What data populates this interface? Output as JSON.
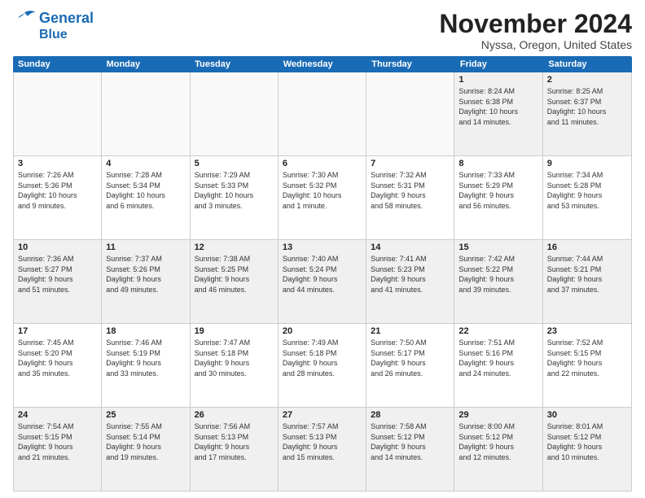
{
  "logo": {
    "line1": "General",
    "line2": "Blue"
  },
  "title": "November 2024",
  "subtitle": "Nyssa, Oregon, United States",
  "days_of_week": [
    "Sunday",
    "Monday",
    "Tuesday",
    "Wednesday",
    "Thursday",
    "Friday",
    "Saturday"
  ],
  "weeks": [
    [
      {
        "day": "",
        "info": "",
        "empty": true
      },
      {
        "day": "",
        "info": "",
        "empty": true
      },
      {
        "day": "",
        "info": "",
        "empty": true
      },
      {
        "day": "",
        "info": "",
        "empty": true
      },
      {
        "day": "",
        "info": "",
        "empty": true
      },
      {
        "day": "1",
        "info": "Sunrise: 8:24 AM\nSunset: 6:38 PM\nDaylight: 10 hours\nand 14 minutes."
      },
      {
        "day": "2",
        "info": "Sunrise: 8:25 AM\nSunset: 6:37 PM\nDaylight: 10 hours\nand 11 minutes."
      }
    ],
    [
      {
        "day": "3",
        "info": "Sunrise: 7:26 AM\nSunset: 5:36 PM\nDaylight: 10 hours\nand 9 minutes."
      },
      {
        "day": "4",
        "info": "Sunrise: 7:28 AM\nSunset: 5:34 PM\nDaylight: 10 hours\nand 6 minutes."
      },
      {
        "day": "5",
        "info": "Sunrise: 7:29 AM\nSunset: 5:33 PM\nDaylight: 10 hours\nand 3 minutes."
      },
      {
        "day": "6",
        "info": "Sunrise: 7:30 AM\nSunset: 5:32 PM\nDaylight: 10 hours\nand 1 minute."
      },
      {
        "day": "7",
        "info": "Sunrise: 7:32 AM\nSunset: 5:31 PM\nDaylight: 9 hours\nand 58 minutes."
      },
      {
        "day": "8",
        "info": "Sunrise: 7:33 AM\nSunset: 5:29 PM\nDaylight: 9 hours\nand 56 minutes."
      },
      {
        "day": "9",
        "info": "Sunrise: 7:34 AM\nSunset: 5:28 PM\nDaylight: 9 hours\nand 53 minutes."
      }
    ],
    [
      {
        "day": "10",
        "info": "Sunrise: 7:36 AM\nSunset: 5:27 PM\nDaylight: 9 hours\nand 51 minutes."
      },
      {
        "day": "11",
        "info": "Sunrise: 7:37 AM\nSunset: 5:26 PM\nDaylight: 9 hours\nand 49 minutes."
      },
      {
        "day": "12",
        "info": "Sunrise: 7:38 AM\nSunset: 5:25 PM\nDaylight: 9 hours\nand 46 minutes."
      },
      {
        "day": "13",
        "info": "Sunrise: 7:40 AM\nSunset: 5:24 PM\nDaylight: 9 hours\nand 44 minutes."
      },
      {
        "day": "14",
        "info": "Sunrise: 7:41 AM\nSunset: 5:23 PM\nDaylight: 9 hours\nand 41 minutes."
      },
      {
        "day": "15",
        "info": "Sunrise: 7:42 AM\nSunset: 5:22 PM\nDaylight: 9 hours\nand 39 minutes."
      },
      {
        "day": "16",
        "info": "Sunrise: 7:44 AM\nSunset: 5:21 PM\nDaylight: 9 hours\nand 37 minutes."
      }
    ],
    [
      {
        "day": "17",
        "info": "Sunrise: 7:45 AM\nSunset: 5:20 PM\nDaylight: 9 hours\nand 35 minutes."
      },
      {
        "day": "18",
        "info": "Sunrise: 7:46 AM\nSunset: 5:19 PM\nDaylight: 9 hours\nand 33 minutes."
      },
      {
        "day": "19",
        "info": "Sunrise: 7:47 AM\nSunset: 5:18 PM\nDaylight: 9 hours\nand 30 minutes."
      },
      {
        "day": "20",
        "info": "Sunrise: 7:49 AM\nSunset: 5:18 PM\nDaylight: 9 hours\nand 28 minutes."
      },
      {
        "day": "21",
        "info": "Sunrise: 7:50 AM\nSunset: 5:17 PM\nDaylight: 9 hours\nand 26 minutes."
      },
      {
        "day": "22",
        "info": "Sunrise: 7:51 AM\nSunset: 5:16 PM\nDaylight: 9 hours\nand 24 minutes."
      },
      {
        "day": "23",
        "info": "Sunrise: 7:52 AM\nSunset: 5:15 PM\nDaylight: 9 hours\nand 22 minutes."
      }
    ],
    [
      {
        "day": "24",
        "info": "Sunrise: 7:54 AM\nSunset: 5:15 PM\nDaylight: 9 hours\nand 21 minutes."
      },
      {
        "day": "25",
        "info": "Sunrise: 7:55 AM\nSunset: 5:14 PM\nDaylight: 9 hours\nand 19 minutes."
      },
      {
        "day": "26",
        "info": "Sunrise: 7:56 AM\nSunset: 5:13 PM\nDaylight: 9 hours\nand 17 minutes."
      },
      {
        "day": "27",
        "info": "Sunrise: 7:57 AM\nSunset: 5:13 PM\nDaylight: 9 hours\nand 15 minutes."
      },
      {
        "day": "28",
        "info": "Sunrise: 7:58 AM\nSunset: 5:12 PM\nDaylight: 9 hours\nand 14 minutes."
      },
      {
        "day": "29",
        "info": "Sunrise: 8:00 AM\nSunset: 5:12 PM\nDaylight: 9 hours\nand 12 minutes."
      },
      {
        "day": "30",
        "info": "Sunrise: 8:01 AM\nSunset: 5:12 PM\nDaylight: 9 hours\nand 10 minutes."
      }
    ]
  ]
}
